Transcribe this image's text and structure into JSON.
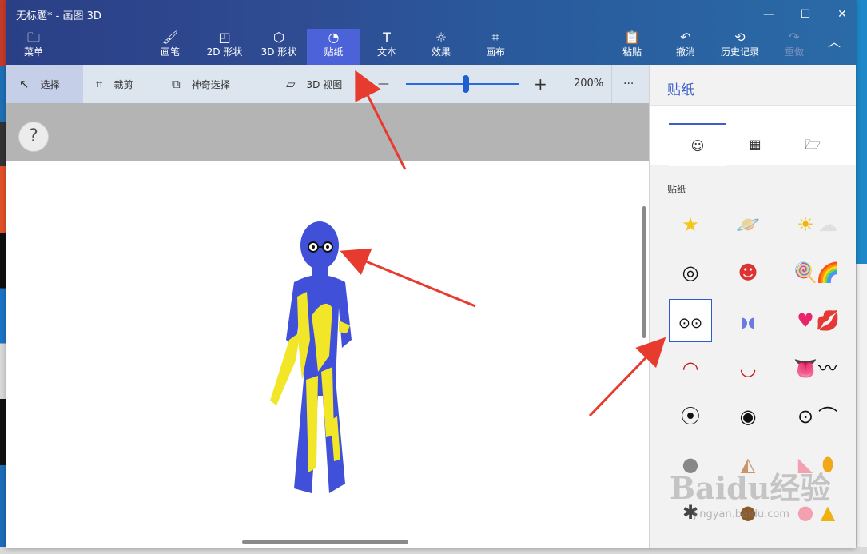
{
  "window": {
    "title": "无标题* - 画图 3D"
  },
  "window_controls": {
    "minimize": "—",
    "maximize": "☐",
    "close": "✕"
  },
  "ribbon": {
    "menu": "菜单",
    "brushes": "画笔",
    "shapes2d": "2D 形状",
    "shapes3d": "3D 形状",
    "stickers": "贴纸",
    "text": "文本",
    "effects": "效果",
    "canvas": "画布",
    "paste": "粘贴",
    "undo": "撤消",
    "history": "历史记录",
    "redo": "重做",
    "collapse": "︿"
  },
  "toolbar": {
    "select": "选择",
    "crop": "裁剪",
    "magic_select": "神奇选择",
    "view3d": "3D 视图",
    "zoom_out": "—",
    "zoom_in": "+",
    "zoom_level": "200%",
    "more": "···"
  },
  "canvas": {
    "help": "?"
  },
  "panel": {
    "title": "贴纸",
    "section_label": "贴纸",
    "tabs": [
      {
        "name": "stickers",
        "icon": "sticker-icon"
      },
      {
        "name": "textures",
        "icon": "texture-icon"
      },
      {
        "name": "custom",
        "icon": "folder-icon"
      }
    ],
    "selected_sticker": "glasses"
  },
  "watermark": {
    "main": "Baidu经验",
    "sub": "jingyan.baidu.com"
  },
  "colors": {
    "accent": "#3a5fcd",
    "ribbon": "#2f4c93",
    "figure_blue": "#4150d8",
    "figure_yellow": "#f2e629",
    "arrow": "#e63b2e"
  }
}
